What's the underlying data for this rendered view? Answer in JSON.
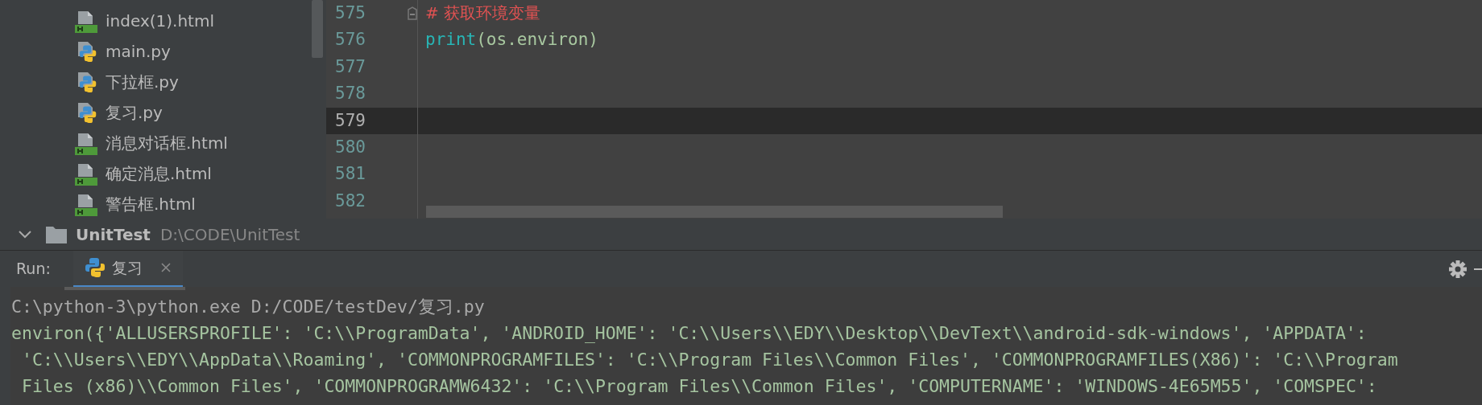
{
  "sidebar": {
    "items": [
      {
        "kind": "html",
        "name": "index(1).html"
      },
      {
        "kind": "python",
        "name": "main.py"
      },
      {
        "kind": "python",
        "name": "下拉框.py"
      },
      {
        "kind": "python",
        "name": "复习.py"
      },
      {
        "kind": "html",
        "name": "消息对话框.html"
      },
      {
        "kind": "html",
        "name": "确定消息.html"
      },
      {
        "kind": "html",
        "name": "警告框.html"
      },
      {
        "kind": "folder",
        "name": "UnitTest",
        "path": "D:\\CODE\\UnitTest",
        "expanded": true
      }
    ]
  },
  "editor": {
    "lines": [
      {
        "number": "575",
        "current": false,
        "fold": true,
        "segments": [
          {
            "kind": "comment",
            "text": "# 获取环境变量"
          }
        ]
      },
      {
        "number": "576",
        "current": false,
        "fold": false,
        "segments": [
          {
            "kind": "builtin",
            "text": "print"
          },
          {
            "kind": "plain",
            "text": "(os.environ)"
          }
        ]
      },
      {
        "number": "577",
        "current": false,
        "fold": false
      },
      {
        "number": "578",
        "current": false,
        "fold": false
      },
      {
        "number": "579",
        "current": true,
        "fold": false
      },
      {
        "number": "580",
        "current": false,
        "fold": false
      },
      {
        "number": "581",
        "current": false,
        "fold": false
      },
      {
        "number": "582",
        "current": false,
        "fold": false
      }
    ]
  },
  "run": {
    "label": "Run:",
    "tabs": [
      {
        "label": "复习",
        "selected": true
      }
    ]
  },
  "console": {
    "lines": [
      {
        "kind": "command",
        "text": "C:\\python-3\\python.exe D:/CODE/testDev/复习.py"
      },
      {
        "kind": "output",
        "text": "environ({'ALLUSERSPROFILE': 'C:\\\\ProgramData', 'ANDROID_HOME': 'C:\\\\Users\\\\EDY\\\\Desktop\\\\DevText\\\\android-sdk-windows', 'APPDATA':"
      },
      {
        "kind": "continuation",
        "text": "'C:\\\\Users\\\\EDY\\\\AppData\\\\Roaming', 'COMMONPROGRAMFILES': 'C:\\\\Program Files\\\\Common Files', 'COMMONPROGRAMFILES(X86)': 'C:\\\\Program"
      },
      {
        "kind": "continuation",
        "text": "Files (x86)\\\\Common Files', 'COMMONPROGRAMW6432': 'C:\\\\Program Files\\\\Common Files', 'COMPUTERNAME': 'WINDOWS-4E65M55', 'COMSPEC':"
      }
    ]
  }
}
